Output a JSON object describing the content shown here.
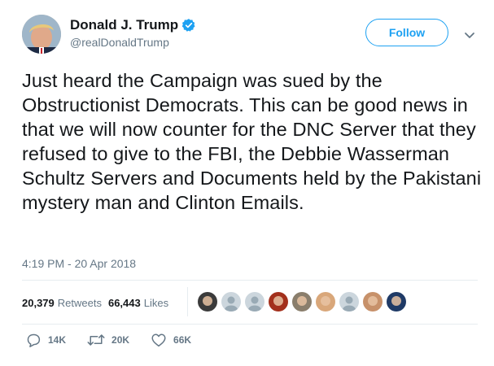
{
  "author": {
    "display_name": "Donald J. Trump",
    "screen_name": "@realDonaldTrump",
    "verified_icon": "verified-badge-icon",
    "verified_color": "#1da1f2"
  },
  "header": {
    "follow_label": "Follow",
    "caret_icon": "chevron-down-icon"
  },
  "tweet": {
    "text": "Just heard the Campaign was sued by the Obstructionist Democrats. This can be good news in that we will now counter for the DNC Server that they refused to give to the FBI, the Debbie Wasserman Schultz Servers and Documents held by the Pakistani mystery man and Clinton Emails.",
    "timestamp": "4:19 PM - 20 Apr 2018"
  },
  "stats": {
    "retweets_count": "20,379",
    "retweets_label": "Retweets",
    "likes_count": "66,443",
    "likes_label": "Likes"
  },
  "liked_by_avatars": [
    {
      "icon": "user-avatar",
      "color": "#3b3b3b"
    },
    {
      "icon": "default-avatar",
      "color": "#99aab5"
    },
    {
      "icon": "default-avatar",
      "color": "#99aab5"
    },
    {
      "icon": "user-avatar",
      "color": "#a3301c"
    },
    {
      "icon": "user-avatar",
      "color": "#8a7e6c"
    },
    {
      "icon": "user-avatar",
      "color": "#d9a77a"
    },
    {
      "icon": "default-avatar",
      "color": "#99aab5"
    },
    {
      "icon": "user-avatar",
      "color": "#c7916a"
    },
    {
      "icon": "user-avatar",
      "color": "#1f3a66"
    }
  ],
  "actions": {
    "reply_icon": "reply-icon",
    "reply_count": "14K",
    "retweet_icon": "retweet-icon",
    "retweet_count": "20K",
    "like_icon": "heart-icon",
    "like_count": "66K"
  },
  "colors": {
    "accent": "#1da1f2",
    "secondary_text": "#657786",
    "divider": "#e6ecf0"
  }
}
